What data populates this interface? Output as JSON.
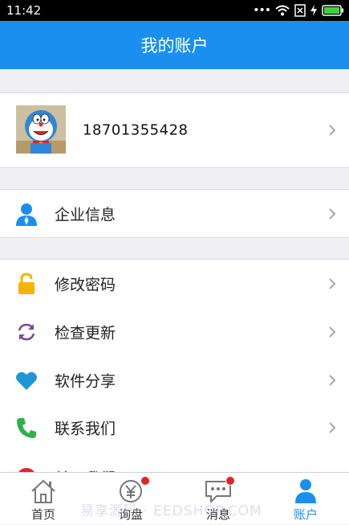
{
  "status_bar": {
    "time": "11:42"
  },
  "header": {
    "title": "我的账户"
  },
  "profile": {
    "phone": "18701355428"
  },
  "menu": {
    "company_info": "企业信息",
    "change_password": "修改密码",
    "check_update": "检查更新",
    "share_software": "软件分享",
    "contact_us": "联系我们",
    "partial_item": "关于我们"
  },
  "tabs": [
    {
      "label": "首页",
      "icon": "home-icon"
    },
    {
      "label": "询盘",
      "icon": "inquiry-icon"
    },
    {
      "label": "消息",
      "icon": "message-icon"
    },
    {
      "label": "账户",
      "icon": "account-icon"
    }
  ],
  "watermark": "易享源码 · EEDSHOP.COM",
  "colors": {
    "accent": "#1a8ff0",
    "badge": "#e5232a",
    "background": "#efeff4"
  }
}
